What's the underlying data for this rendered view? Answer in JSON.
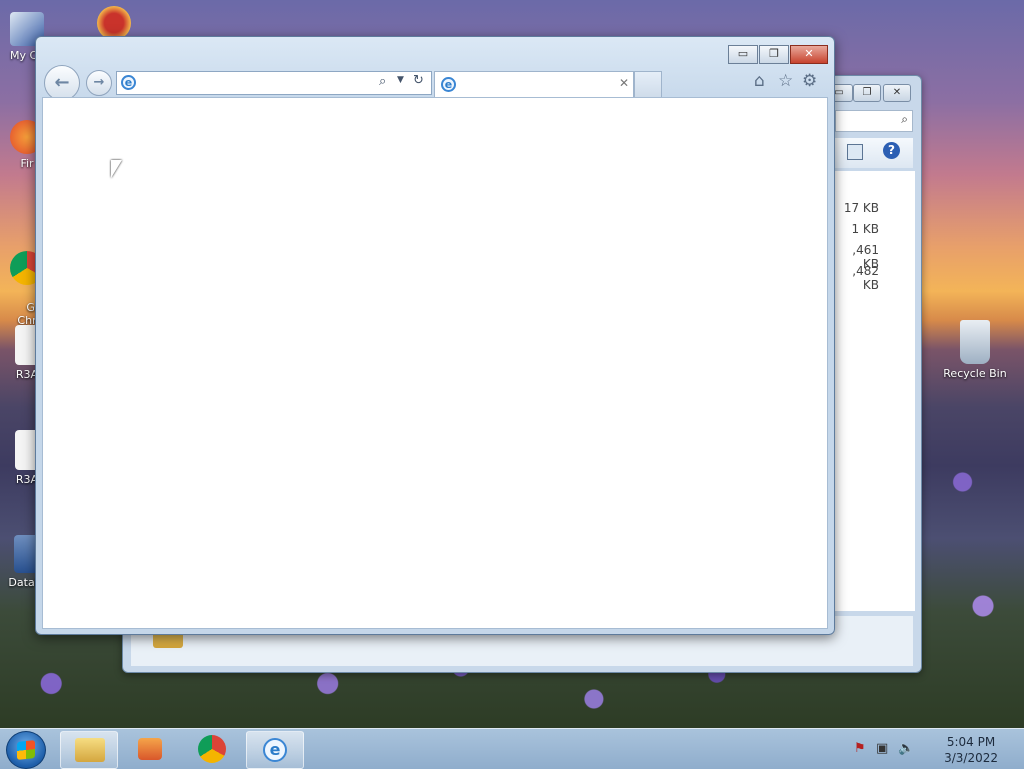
{
  "desktop": {
    "icons": [
      {
        "label": "My Co"
      },
      {
        "label": "Fir"
      },
      {
        "label": "Go\nChr"
      },
      {
        "label": "R3A"
      },
      {
        "label": "R3A"
      },
      {
        "label": "DataW"
      },
      {
        "label": "Recycle Bin"
      }
    ]
  },
  "explorer": {
    "sizes": [
      "17 KB",
      "1 KB",
      ",461 KB",
      ",482 KB"
    ]
  },
  "browser": {
    "address_value": "",
    "tab_title": "",
    "minimize": "▭",
    "maximize": "❐",
    "close": "✕"
  },
  "taskbar": {
    "time": "5:04 PM",
    "date": "3/3/2022"
  },
  "icons": [
    "back-icon",
    "forward-icon",
    "search-icon",
    "dropdown-icon",
    "refresh-icon",
    "home-icon",
    "favorites-icon",
    "settings-icon",
    "close-tab-icon"
  ]
}
